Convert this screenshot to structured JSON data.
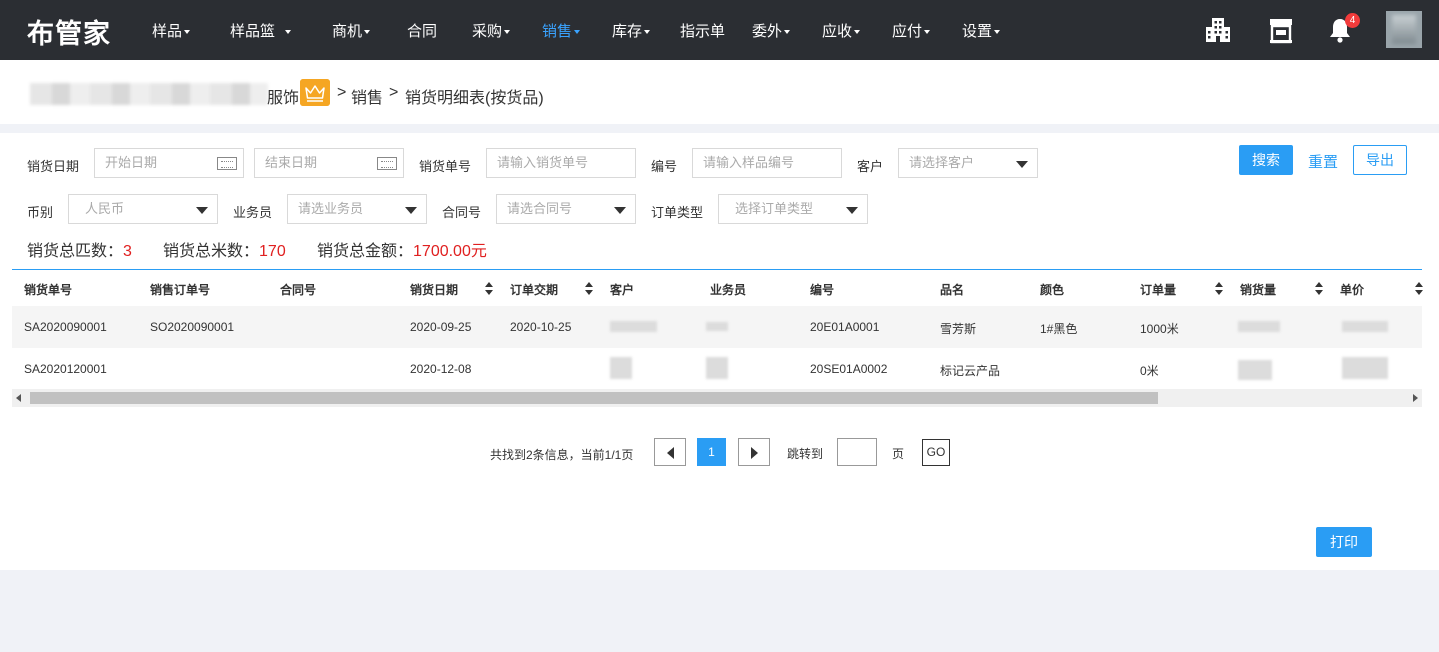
{
  "app": {
    "logo": "布管家",
    "nav": [
      {
        "label": "样品",
        "dropdown": true,
        "active": false
      },
      {
        "label": "样品篮",
        "dropdown": true,
        "active": false
      },
      {
        "label": "商机",
        "dropdown": true,
        "active": false
      },
      {
        "label": "合同",
        "dropdown": false,
        "active": false
      },
      {
        "label": "采购",
        "dropdown": true,
        "active": false
      },
      {
        "label": "销售",
        "dropdown": true,
        "active": true
      },
      {
        "label": "库存",
        "dropdown": true,
        "active": false
      },
      {
        "label": "指示单",
        "dropdown": false,
        "active": false
      },
      {
        "label": "委外",
        "dropdown": true,
        "active": false
      },
      {
        "label": "应收",
        "dropdown": true,
        "active": false
      },
      {
        "label": "应付",
        "dropdown": true,
        "active": false
      },
      {
        "label": "设置",
        "dropdown": true,
        "active": false
      }
    ],
    "notification_count": "4",
    "colors": {
      "topbar": "#2b2e33",
      "accent": "#2a9df4",
      "nav_active": "#3aa3ff",
      "badge": "#f23b3b",
      "crown": "#f5a623",
      "highlight_number": "#e02020"
    }
  },
  "breadcrumb": {
    "company_tail": "服饰",
    "sep": ">",
    "level1": "销售",
    "level2": "销货明细表(按货品)"
  },
  "filters": {
    "delivery_date_label": "销货日期",
    "start_date_placeholder": "开始日期",
    "end_date_placeholder": "结束日期",
    "delivery_no_label": "销货单号",
    "delivery_no_placeholder": "请输入销货单号",
    "code_label": "编号",
    "code_placeholder": "请输入样品编号",
    "customer_label": "客户",
    "customer_placeholder": "请选择客户",
    "currency_label": "币别",
    "currency_value": "人民币",
    "salesman_label": "业务员",
    "salesman_placeholder": "请选业务员",
    "contract_label": "合同号",
    "contract_placeholder": "请选合同号",
    "order_type_label": "订单类型",
    "order_type_placeholder": "选择订单类型"
  },
  "actions": {
    "search": "搜索",
    "reset": "重置",
    "export": "导出",
    "print": "打印"
  },
  "summary": {
    "pieces_label": "销货总匹数：",
    "pieces_value": "3",
    "meters_label": "销货总米数：",
    "meters_value": "170",
    "amount_label": "销货总金额：",
    "amount_value": "1700.00元"
  },
  "table": {
    "headers": [
      "销货单号",
      "销售订单号",
      "合同号",
      "销货日期",
      "订单交期",
      "客户",
      "业务员",
      "编号",
      "品名",
      "颜色",
      "订单量",
      "销货量",
      "单价"
    ],
    "rows": [
      {
        "delivery_no": "SA2020090001",
        "order_no": "SO2020090001",
        "contract": "",
        "date": "2020-09-25",
        "due": "2020-10-25",
        "code": "20E01A0001",
        "name": "雪芳斯",
        "color": "1#黑色",
        "order_qty": "1000米"
      },
      {
        "delivery_no": "SA2020120001",
        "order_no": "",
        "contract": "",
        "date": "2020-12-08",
        "due": "",
        "code": "20SE01A0002",
        "name": "标记云产品",
        "color": "",
        "order_qty": "0米"
      }
    ]
  },
  "pagination": {
    "info": "共找到2条信息，当前1/1页",
    "current": "1",
    "jump_label": "跳转到",
    "page_unit": "页",
    "go": "GO"
  }
}
